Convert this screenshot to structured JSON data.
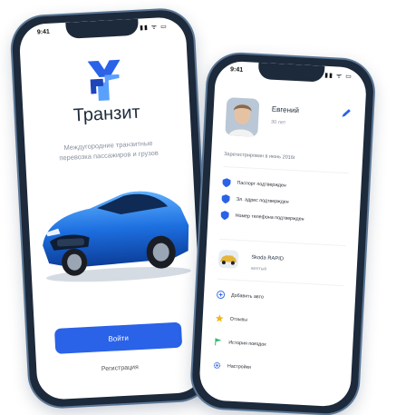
{
  "phone1": {
    "time": "9:41",
    "signal": "▮▮ ᯤ ▭",
    "brand": "Транзит",
    "tagline_line1": "Междугородние транзитные",
    "tagline_line2": "перевозка пассажиров и грузов",
    "login_label": "Войти",
    "register_label": "Регистрация"
  },
  "phone2": {
    "time": "9:41",
    "signal": "▮▮ ᯤ ▭",
    "profile": {
      "name": "Евгений",
      "age": "30 лет"
    },
    "registered": "Зарегестрирован в июнь 2016г",
    "verifications": [
      {
        "label": "Паспорт подтвержден"
      },
      {
        "label": "Эл. адрес подтвержден"
      },
      {
        "label": "Номер телефона подтвержден"
      }
    ],
    "car": {
      "model": "Skoda RAPID",
      "color": "желтый"
    },
    "menu": [
      {
        "label": "Добавить авто",
        "icon": "plus-circle-icon"
      },
      {
        "label": "Отзывы",
        "icon": "star-icon"
      },
      {
        "label": "История поездок",
        "icon": "flag-icon"
      },
      {
        "label": "Настройки",
        "icon": "gear-icon"
      }
    ]
  },
  "colors": {
    "accent": "#2a62e8",
    "verified": "#2a62e8",
    "star": "#f2b71d",
    "flag": "#2fb86a"
  }
}
